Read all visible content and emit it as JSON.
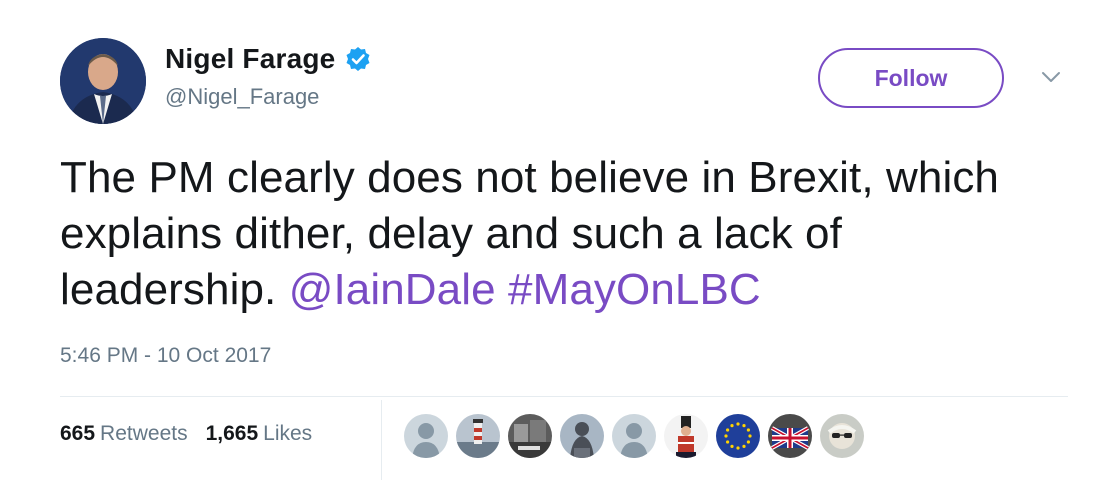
{
  "user": {
    "display_name": "Nigel Farage",
    "handle": "@Nigel_Farage",
    "verified": true,
    "avatar_icon": "profile-photo"
  },
  "follow_button": {
    "label": "Follow",
    "color": "#794bc4"
  },
  "menu": {
    "icon": "chevron-down-icon"
  },
  "tweet": {
    "text_plain": "The PM clearly does not believe in Brexit, which explains dither, delay and such a lack of leadership. ",
    "mention": "@IainDale",
    "hashtag": "#MayOnLBC",
    "link_color": "#794bc4",
    "timestamp": "5:46 PM - 10 Oct 2017"
  },
  "stats": {
    "retweets_count": "665",
    "retweets_label": "Retweets",
    "likes_count": "1,665",
    "likes_label": "Likes"
  },
  "likers": [
    {
      "icon": "default-avatar-icon"
    },
    {
      "icon": "lighthouse-avatar"
    },
    {
      "icon": "mono-photo-avatar"
    },
    {
      "icon": "statue-avatar"
    },
    {
      "icon": "default-avatar-icon"
    },
    {
      "icon": "soldier-avatar"
    },
    {
      "icon": "eu-flag-avatar"
    },
    {
      "icon": "union-jack-avatar"
    },
    {
      "icon": "sunglasses-avatar"
    }
  ]
}
